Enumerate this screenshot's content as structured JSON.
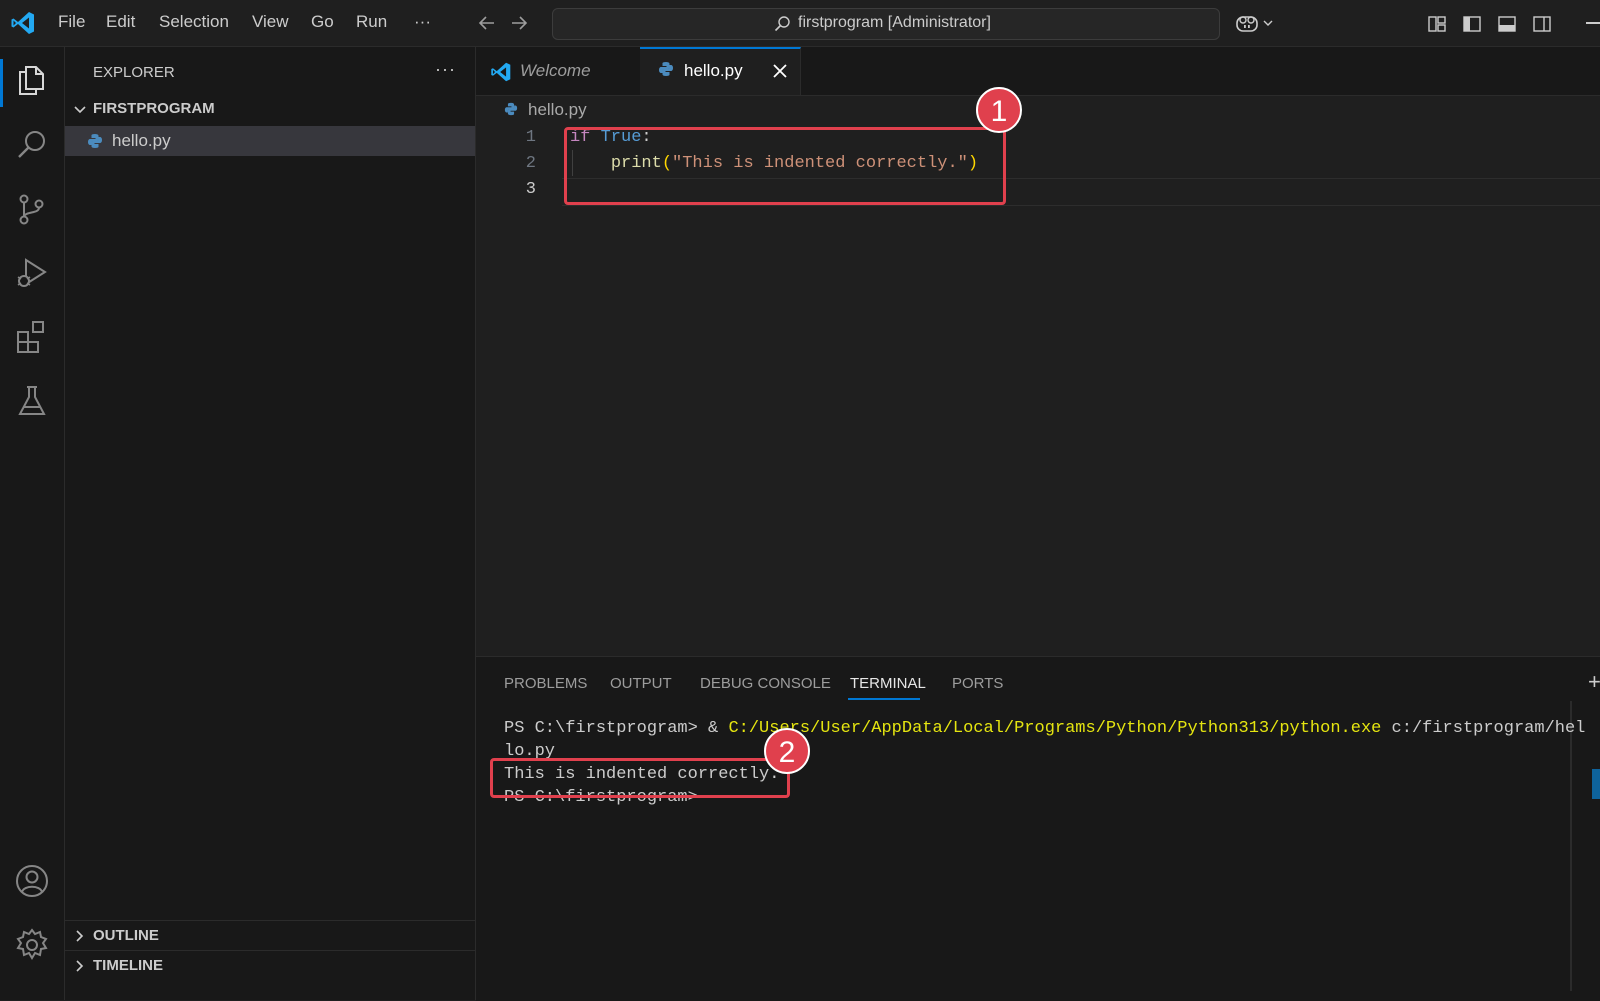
{
  "titlebar": {
    "menu": [
      "File",
      "Edit",
      "Selection",
      "View",
      "Go",
      "Run",
      "···"
    ],
    "search_text": "firstprogram [Administrator]"
  },
  "sidebar": {
    "title": "EXPLORER",
    "more": "···",
    "folder": "FIRSTPROGRAM",
    "files": [
      {
        "name": "hello.py",
        "icon": "python-icon",
        "selected": true
      }
    ],
    "sections": [
      "OUTLINE",
      "TIMELINE"
    ]
  },
  "editor": {
    "tabs": [
      {
        "label": "Welcome",
        "icon": "vscode-icon",
        "active": false
      },
      {
        "label": "hello.py",
        "icon": "python-icon",
        "active": true
      }
    ],
    "breadcrumb": "hello.py",
    "line_numbers": [
      "1",
      "2",
      "3"
    ],
    "code": {
      "l1_kw": "if",
      "l1_val": "True",
      "l1_colon": ":",
      "l2_fn": "print",
      "l2_open": "(",
      "l2_str": "\"This is indented correctly.\"",
      "l2_close": ")"
    }
  },
  "panel": {
    "tabs": [
      "PROBLEMS",
      "OUTPUT",
      "DEBUG CONSOLE",
      "TERMINAL",
      "PORTS"
    ],
    "active_tab": "TERMINAL",
    "terminal": {
      "line1_prompt": "PS C:\\firstprogram> & ",
      "line1_path": "C:/Users/User/AppData/Local/Programs/Python/Python313/python.exe",
      "line1_arg": " c:/firstprogram/hel",
      "line2": "lo.py",
      "line3": "This is indented correctly.",
      "line4": "PS C:\\firstprogram>"
    }
  },
  "annotations": {
    "badge1": "1",
    "badge2": "2",
    "color": "#e0404d"
  },
  "colors": {
    "accent": "#0078d4",
    "keyword": "#c586c0",
    "constant": "#569cd6",
    "function": "#dcdcaa",
    "string": "#ce9178",
    "terminal_path": "#e5e510"
  }
}
